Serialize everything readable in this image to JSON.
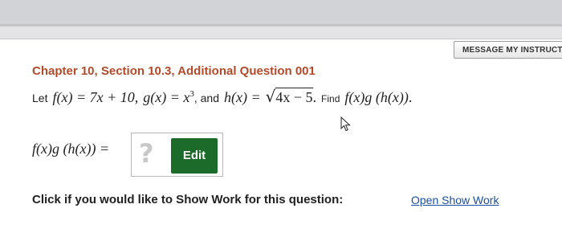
{
  "header": {
    "message_button_label": "MESSAGE MY INSTRUCTO"
  },
  "question": {
    "heading": "Chapter 10, Section 10.3, Additional Question 001",
    "prompt_let": "Let",
    "f_def": "f(x) = 7x + 10",
    "sep1": ",",
    "g_def_prefix": "g(x) = x",
    "g_exponent": "3",
    "sep2": ", and",
    "h_prefix": "h(x) =",
    "sqrt_symbol": "√",
    "radicand": "4x − 5",
    "period": ".",
    "find_label": "Find",
    "find_expression": "f(x)g (h(x))",
    "find_period": "."
  },
  "answer": {
    "lhs": "f(x)g (h(x)) =",
    "placeholder_symbol": "?",
    "edit_label": "Edit"
  },
  "show_work": {
    "prompt": "Click if you would like to Show Work for this question:",
    "link_label": "Open Show Work"
  }
}
